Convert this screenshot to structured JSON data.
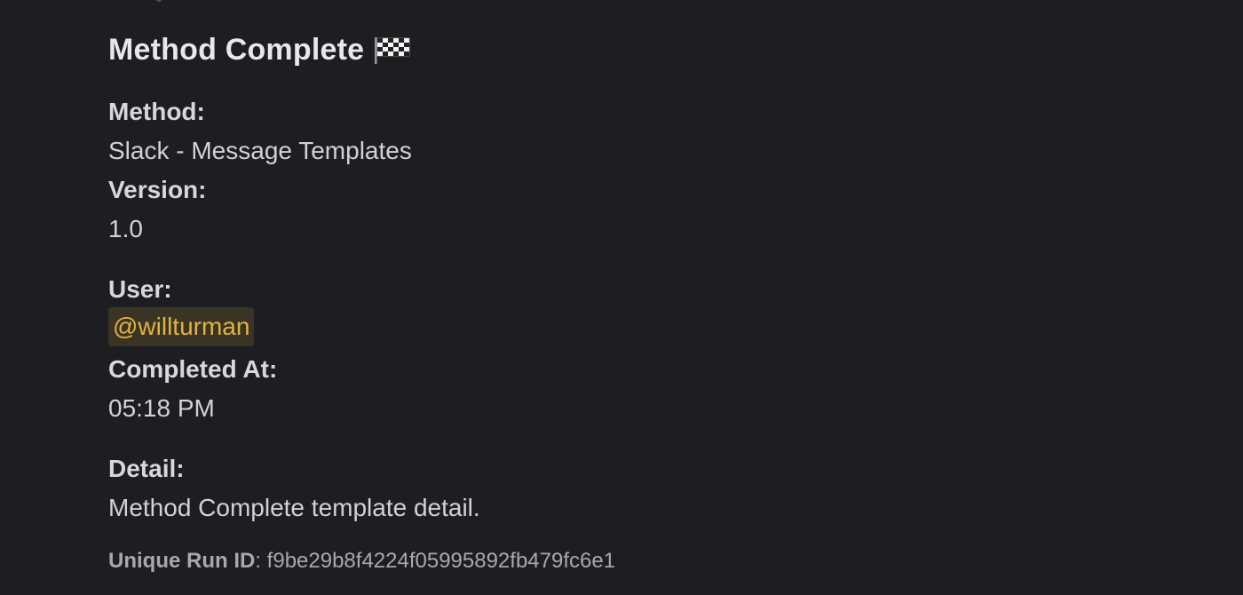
{
  "message": {
    "title": "Method Complete",
    "title_icon": "checkered-flag-icon",
    "fields": {
      "method_label": "Method:",
      "method_value": "Slack - Message Templates",
      "version_label": "Version:",
      "version_value": "1.0",
      "user_label": "User:",
      "user_mention": "@willturman",
      "completed_label": "Completed At:",
      "completed_value": "05:18 PM",
      "detail_label": "Detail:",
      "detail_value": "Method Complete template detail."
    },
    "footer": {
      "run_id_label": "Unique Run ID",
      "run_id_separator": ": ",
      "run_id_value": "f9be29b8f4224f05995892fb479fc6e1"
    }
  },
  "colors": {
    "background": "#1d1e22",
    "text": "#d1d2d3",
    "mention_text": "#e2b340",
    "mention_background": "#3a3425",
    "footer_text": "#a8a9ab"
  }
}
